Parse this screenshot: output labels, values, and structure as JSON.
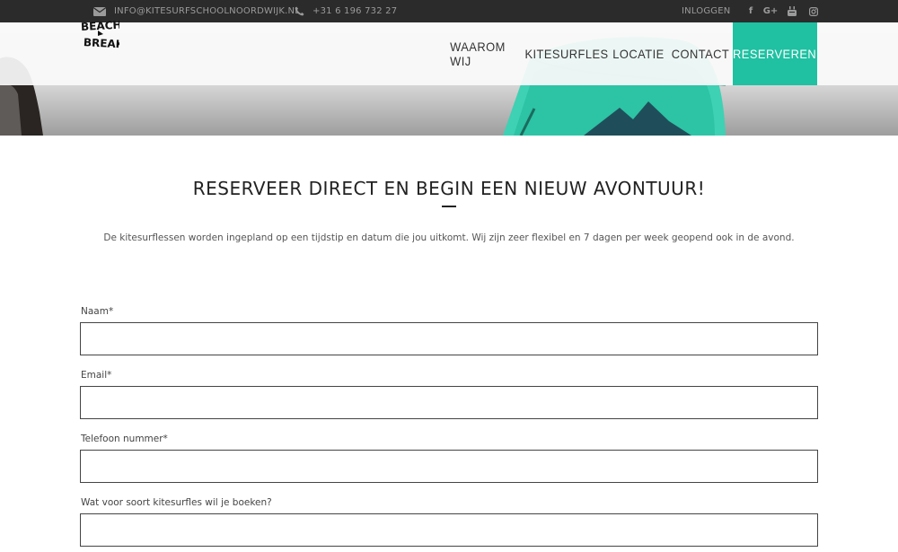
{
  "topbar": {
    "email": "INFO@KITESURFSCHOOLNOORDWIJK.NL",
    "phone": "+31 6 196 732 27",
    "login": "INLOGGEN",
    "social": {
      "facebook": "f",
      "googleplus": "G+"
    }
  },
  "logo": {
    "line1": "BEACH",
    "line2": "BREAK"
  },
  "nav": {
    "items": [
      "WAAROM WIJ",
      "KITESURFLES",
      "LOCATIE",
      "CONTACT"
    ],
    "cta": "RESERVEREN"
  },
  "main": {
    "heading": "RESERVEER DIRECT EN BEGIN EEN NIEUW AVONTUUR!",
    "intro": "De kitesurflessen worden ingepland op een tijdstip en datum die jou uitkomt. Wij zijn zeer flexibel en 7 dagen per week geopend ook in de avond."
  },
  "form": {
    "fields": [
      {
        "label": "Naam*",
        "value": ""
      },
      {
        "label": "Email*",
        "value": ""
      },
      {
        "label": "Telefoon nummer*",
        "value": ""
      },
      {
        "label": "Wat voor soort kitesurfles wil je boeken?",
        "value": ""
      }
    ]
  },
  "colors": {
    "accent": "#1fc1a2",
    "topbar": "#2b2b2b",
    "kite": "#3ed1b3"
  },
  "icons": [
    "envelope-icon",
    "phone-icon",
    "facebook-icon",
    "google-plus-icon",
    "youtube-icon",
    "instagram-icon"
  ]
}
